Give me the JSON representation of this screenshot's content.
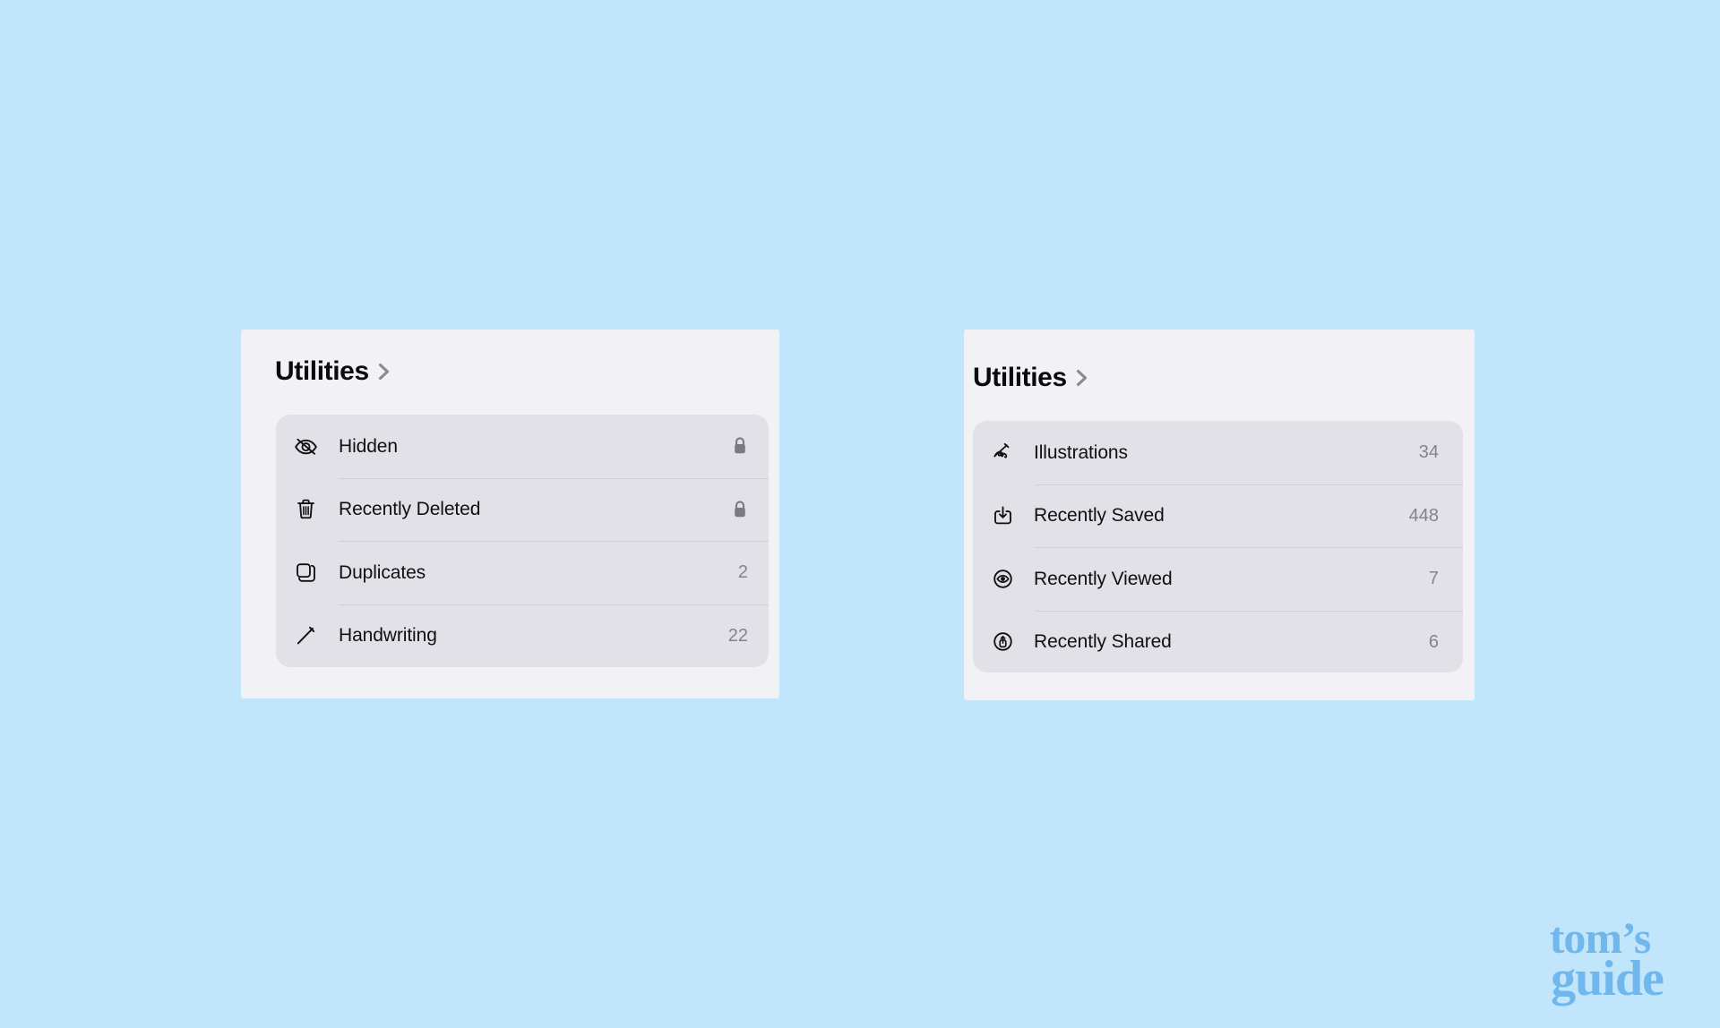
{
  "background_color": "#c1e6fc",
  "panels": [
    {
      "id": "utilities-left",
      "title": "Utilities",
      "disclosure_icon": "chevron-right-icon",
      "card_color": "#e2e1e7",
      "panel_color": "#f2f1f4",
      "items": [
        {
          "label": "Hidden",
          "icon": "eye-slash-icon",
          "accessory": "lock",
          "count": ""
        },
        {
          "label": "Recently Deleted",
          "icon": "trash-icon",
          "accessory": "lock",
          "count": ""
        },
        {
          "label": "Duplicates",
          "icon": "duplicate-icon",
          "accessory": "count",
          "count": "2"
        },
        {
          "label": "Handwriting",
          "icon": "pencil-icon",
          "accessory": "count",
          "count": "22"
        }
      ]
    },
    {
      "id": "utilities-right",
      "title": "Utilities",
      "disclosure_icon": "chevron-right-icon",
      "card_color": "#e2e1e7",
      "panel_color": "#f2f1f4",
      "items": [
        {
          "label": "Illustrations",
          "icon": "scribble-icon",
          "accessory": "count",
          "count": "34"
        },
        {
          "label": "Recently Saved",
          "icon": "save-download-icon",
          "accessory": "count",
          "count": "448"
        },
        {
          "label": "Recently Viewed",
          "icon": "eye-circle-icon",
          "accessory": "count",
          "count": "7"
        },
        {
          "label": "Recently Shared",
          "icon": "share-circle-icon",
          "accessory": "count",
          "count": "6"
        }
      ]
    }
  ],
  "watermark": {
    "line1": "tom's",
    "line2": "guide",
    "color": "#6fb7ec"
  }
}
